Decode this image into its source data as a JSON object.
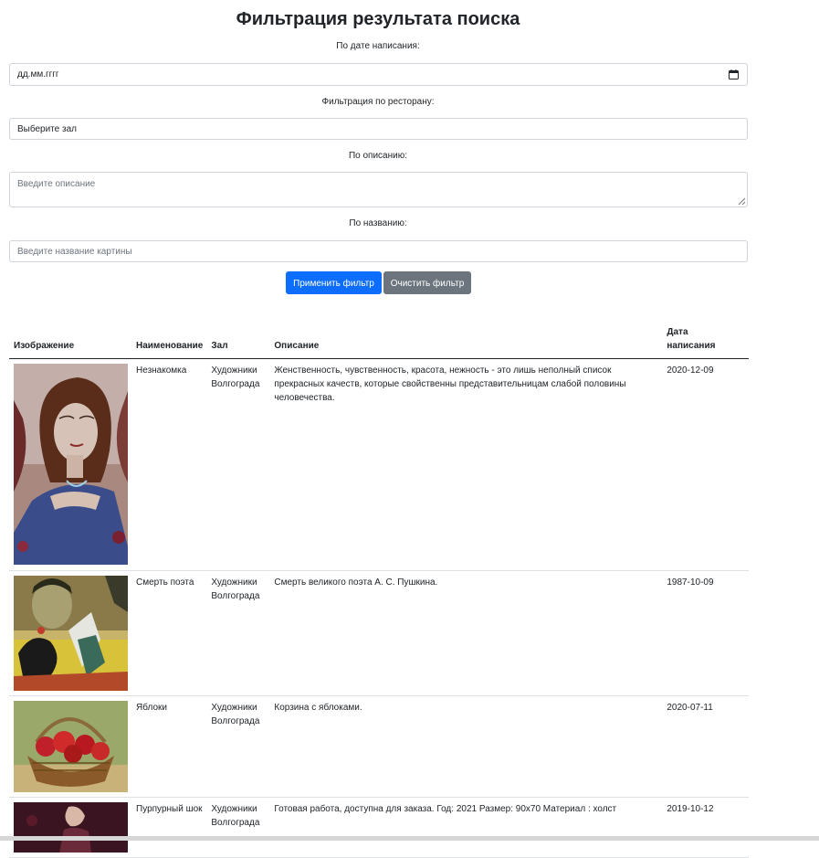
{
  "page": {
    "title": "Фильтрация результата поиска"
  },
  "filters": {
    "date": {
      "label": "По дате написания:",
      "placeholder": "дд.мм.гггг"
    },
    "restaurant": {
      "label": "Фильтрация по ресторану:",
      "value": "Выберите зал"
    },
    "description": {
      "label": "По описанию:",
      "placeholder": "Введите описание"
    },
    "title": {
      "label": "По названию:",
      "placeholder": "Введите название картины"
    },
    "apply_label": "Применить фильтр",
    "clear_label": "Очистить фильтр"
  },
  "table": {
    "headers": {
      "image": "Изображение",
      "name": "Наименование",
      "hall": "Зал",
      "description": "Описание",
      "date_line1": "Дата",
      "date_line2": "написания"
    },
    "rows": [
      {
        "image_icon": "portrait-woman-painting",
        "name": "Незнакомка",
        "hall_line1": "Художники",
        "hall_line2": "Волгограда",
        "description": "Женственность, чувственность, красота, нежность - это лишь неполный список прекрасных качеств, которые свойственны представительницам слабой половины человечества.",
        "date": "2020-12-09"
      },
      {
        "image_icon": "poet-death-painting",
        "name": "Смерть поэта",
        "hall_line1": "Художники",
        "hall_line2": "Волгограда",
        "description": "Смерть великого поэта А. С. Пушкина.",
        "date": "1987-10-09"
      },
      {
        "image_icon": "apple-basket-painting",
        "name": "Яблоки",
        "hall_line1": "Художники",
        "hall_line2": "Волгограда",
        "description": "Корзина с яблоками.",
        "date": "2020-07-11"
      },
      {
        "image_icon": "purple-shock-painting",
        "name": "Пурпурный шок",
        "hall_line1": "Художники",
        "hall_line2": "Волгограда",
        "description": "Готовая работа, доступна для заказа. Год: 2021 Размер: 90х70 Материал : холст",
        "date": "2019-10-12"
      }
    ]
  },
  "colors": {
    "primary": "#0d6efd",
    "secondary": "#6c757d",
    "border": "#ced4da",
    "text": "#212529"
  }
}
